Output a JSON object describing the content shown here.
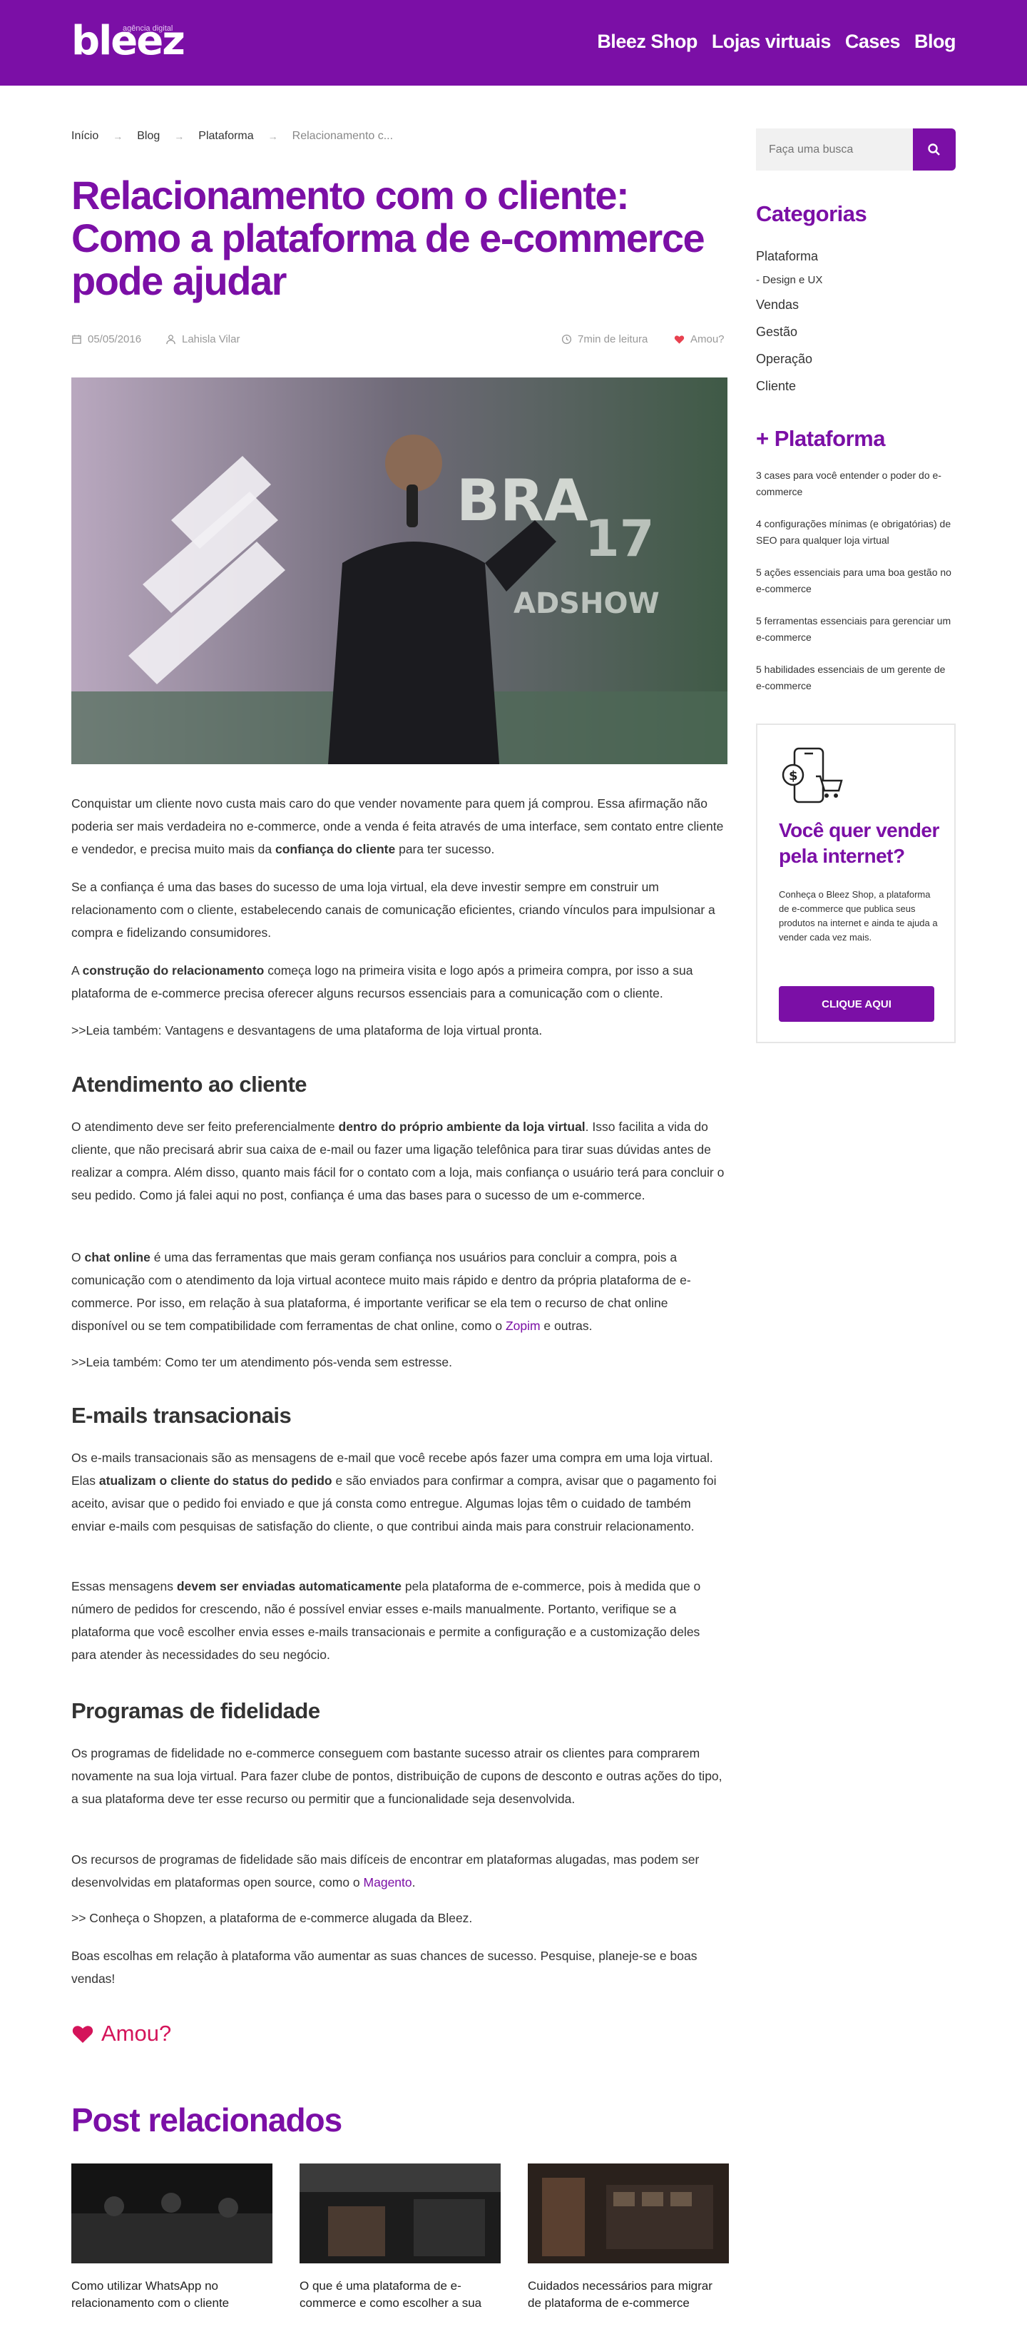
{
  "header": {
    "logo_small": "agência digital",
    "logo_big": "bleez",
    "nav": [
      "Bleez Shop",
      "Lojas virtuais",
      "Cases",
      "Blog"
    ]
  },
  "breadcrumb": [
    "Início",
    "Blog",
    "Plataforma",
    "Relacionamento c..."
  ],
  "post": {
    "title": "Relacionamento com o cliente: Como a plataforma de e-commerce pode ajudar",
    "date": "05/05/2016",
    "author": "Lahisla Vilar",
    "read_time": "7min de leitura",
    "love": "Amou?",
    "p1_a": "Conquistar um cliente novo custa mais caro do que vender novamente para quem já comprou. Essa afirmação não poderia ser mais verdadeira no e-commerce, onde a venda é feita através de uma interface, sem contato entre cliente e vendedor, e precisa muito mais da ",
    "p1_b": "confiança do cliente",
    "p1_c": " para ter sucesso.",
    "p2": "Se a confiança é uma das bases do sucesso de uma loja virtual, ela deve investir sempre em construir um relacionamento com o cliente, estabelecendo canais de comunicação eficientes, criando vínculos para impulsionar a compra e fidelizando consumidores.",
    "p3_a": "A ",
    "p3_b": "construção do relacionamento",
    "p3_c": " começa logo na primeira visita e logo após a primeira compra, por isso a sua plataforma de e-commerce precisa oferecer alguns recursos essenciais para a comunicação com o cliente.",
    "link1": ">>Leia também: Vantagens e desvantagens de uma plataforma de loja virtual pronta.",
    "h_atendimento": "Atendimento ao cliente",
    "p4_a": "O atendimento deve ser feito preferencialmente ",
    "p4_b": "dentro do próprio ambiente da loja virtual",
    "p4_c": ". Isso facilita a vida do cliente, que não precisará abrir sua caixa de e-mail ou fazer uma ligação telefônica para tirar suas dúvidas antes de realizar a compra. Além disso, quanto mais fácil for o contato com a loja, mais confiança o usuário terá para concluir o seu pedido. Como já falei aqui no post, confiança é uma das bases para o sucesso de um e-commerce.",
    "p5_a": "O ",
    "p5_b": "chat online",
    "p5_c": " é uma das ferramentas que mais geram confiança nos usuários para concluir a compra, pois a comunicação com o atendimento da loja virtual acontece muito mais rápido e dentro da própria plataforma de e-commerce. Por isso, em relação à sua plataforma, é importante verificar se ela tem o recurso de chat online disponível ou se tem compatibilidade com ferramentas de chat online, como o ",
    "p5_link": "Zopim",
    "p5_d": " e outras.",
    "link2": ">>Leia também: Como ter um atendimento pós-venda sem estresse.",
    "h_emails": "E-mails transacionais",
    "p6_a": "Os e-mails transacionais são as mensagens de e-mail que você recebe após fazer uma compra em uma loja virtual. Elas ",
    "p6_b": "atualizam o cliente do status do pedido",
    "p6_c": " e são enviados para confirmar a compra, avisar que o pagamento foi aceito, avisar que o pedido foi enviado e que já consta como entregue. Algumas lojas têm o cuidado de também enviar e-mails com pesquisas de satisfação do cliente, o que contribui ainda mais para construir relacionamento.",
    "p7_a": "Essas mensagens ",
    "p7_b": "devem ser enviadas automaticamente",
    "p7_c": " pela plataforma de e-commerce, pois à medida que o número de pedidos for crescendo, não é possível enviar esses e-mails manualmente. Portanto, verifique se a plataforma que você escolher envia esses e-mails transacionais e permite a configuração e a customização deles para atender às necessidades do seu negócio.",
    "h_fidelidade": "Programas de fidelidade",
    "p8": "Os programas de fidelidade no e-commerce conseguem com bastante sucesso atrair os clientes para comprarem novamente na sua loja virtual. Para fazer clube de pontos, distribuição de cupons de desconto e outras ações do tipo, a sua plataforma deve ter esse recurso ou permitir que a funcionalidade seja desenvolvida.",
    "p9_a": "Os recursos de programas de fidelidade são mais difíceis de encontrar em plataformas alugadas, mas podem ser desenvolvidas em plataformas open source, como o ",
    "p9_link": "Magento",
    "p9_b": ".",
    "link3": ">> Conheça o Shopzen, a plataforma de e-commerce alugada da Bleez.",
    "p10": "Boas escolhas em relação à plataforma vão aumentar as suas chances de sucesso. Pesquise, planeje-se e boas vendas!",
    "loved_label": "Amou?"
  },
  "related": {
    "title": "Post relacionados",
    "items": [
      {
        "title": "Como utilizar WhatsApp no relacionamento com o cliente"
      },
      {
        "title": "O que é uma plataforma de e-commerce e como escolher a sua"
      },
      {
        "title": "Cuidados necessários para migrar de plataforma de e-commerce"
      }
    ]
  },
  "sidebar": {
    "search_placeholder": "Faça uma busca",
    "categories_title": "Categorias",
    "categories": [
      "Plataforma",
      "- Design e UX",
      "Vendas",
      "Gestão",
      "Operação",
      "Cliente"
    ],
    "more_title": "+ Plataforma",
    "more_items": [
      "3 cases para você entender o poder do e-commerce",
      "4 configurações mínimas (e obrigatórias) de SEO para qualquer loja virtual",
      "5 ações essenciais para uma boa gestão no e-commerce",
      "5 ferramentas essenciais para gerenciar um e-commerce",
      "5 habilidades essenciais de um gerente de e-commerce"
    ],
    "cta_title": "Você quer vender pela internet?",
    "cta_text": "Conheça o Bleez Shop, a plataforma de e-commerce que publica seus produtos na internet e ainda te ajuda a vender cada vez mais.",
    "cta_button": "CLIQUE AQUI"
  },
  "colors": {
    "brand": "#7b0fa6",
    "love": "#d4145a"
  }
}
